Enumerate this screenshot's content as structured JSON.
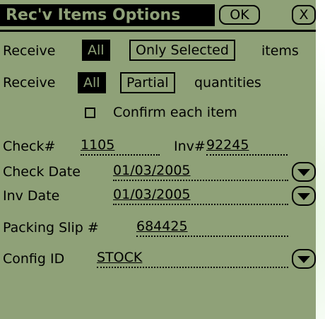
{
  "title": "Rec'v Items Options",
  "buttons": {
    "ok": "OK",
    "close": "X"
  },
  "receive_items": {
    "label": "Receive",
    "opt_all": "All",
    "opt_selected": "Only Selected",
    "suffix": "items",
    "selected": "All"
  },
  "receive_qty": {
    "label": "Receive",
    "opt_all": "All",
    "opt_partial": "Partial",
    "suffix": "quantities",
    "selected": "All"
  },
  "confirm": {
    "label": "Confirm each item",
    "checked": false
  },
  "check_num": {
    "label": "Check#",
    "value": "1105"
  },
  "inv_num": {
    "label": "Inv#",
    "value": "92245"
  },
  "check_date": {
    "label": "Check Date",
    "value": "01/03/2005"
  },
  "inv_date": {
    "label": "Inv Date",
    "value": "01/03/2005"
  },
  "packing_slip": {
    "label": "Packing Slip #",
    "value": "684425"
  },
  "config_id": {
    "label": "Config ID",
    "value": "STOCK"
  },
  "colors": {
    "screen": "#8fa178",
    "ink": "#000000"
  }
}
